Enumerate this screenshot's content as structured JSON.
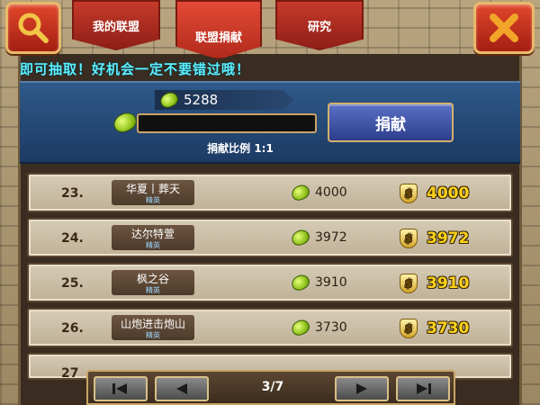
{
  "tabs": [
    {
      "label": "我的联盟"
    },
    {
      "label": "联盟捐献"
    },
    {
      "label": "研究"
    }
  ],
  "marquee": "即可抽取！好机会一定不要错过哦！",
  "donate": {
    "balance": "5288",
    "button_label": "捐献",
    "ratio_text": "捐献比例 1:1",
    "input_value": ""
  },
  "rows": [
    {
      "rank": "23.",
      "name": "华夏丨葬天",
      "role": "精英",
      "gems": "4000",
      "coins": "4000"
    },
    {
      "rank": "24.",
      "name": "达尔特萱",
      "role": "精英",
      "gems": "3972",
      "coins": "3972"
    },
    {
      "rank": "25.",
      "name": "枫之谷",
      "role": "精英",
      "gems": "3910",
      "coins": "3910"
    },
    {
      "rank": "26.",
      "name": "山炮进击炮山",
      "role": "精英",
      "gems": "3730",
      "coins": "3730"
    },
    {
      "rank": "27",
      "name": "",
      "role": "",
      "gems": "",
      "coins": ""
    }
  ],
  "pager": {
    "text": "3/7"
  },
  "icons": {
    "search": "search-icon",
    "close": "close-icon",
    "gem": "gem-icon",
    "coin": "coin-icon",
    "first": "first-page-icon",
    "prev": "prev-page-icon",
    "next": "next-page-icon",
    "last": "last-page-icon"
  },
  "colors": {
    "tab_red": "#c63a2a",
    "marquee_cyan": "#5df0ff",
    "coin_gold": "#ffd21a",
    "panel_blue": "#2e5a8a"
  }
}
